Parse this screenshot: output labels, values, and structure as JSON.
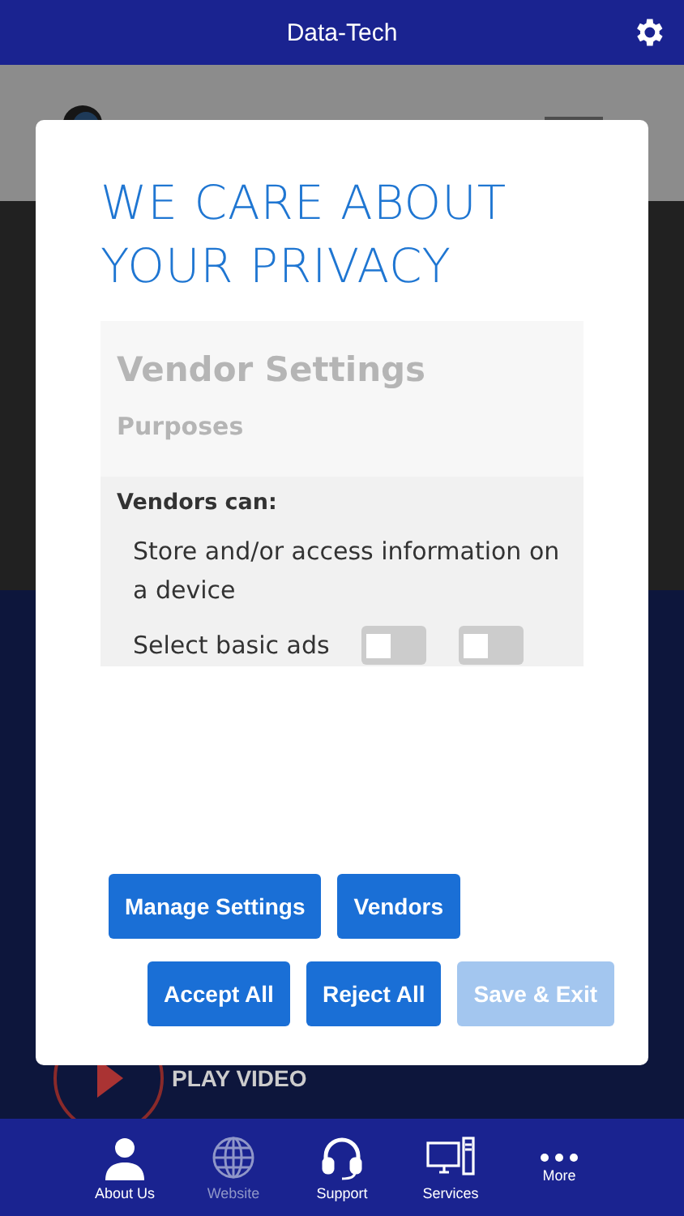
{
  "app_bar": {
    "title": "Data-Tech"
  },
  "background": {
    "play_label": "PLAY VIDEO"
  },
  "dialog": {
    "title": "WE CARE ABOUT YOUR PRIVACY",
    "panel": {
      "heading": "Vendor Settings",
      "subheading": "Purposes",
      "section_label": "Vendors can:",
      "items": [
        {
          "label": "Store and/or access information on a device"
        },
        {
          "label": "Select basic ads",
          "toggles": [
            {
              "checked": false
            },
            {
              "checked": false
            }
          ]
        }
      ]
    },
    "buttons": [
      [
        {
          "label": "Manage Settings",
          "disabled": false
        },
        {
          "label": "Vendors",
          "disabled": false
        }
      ],
      [
        {
          "label": "Accept All",
          "disabled": false
        },
        {
          "label": "Reject All",
          "disabled": false
        },
        {
          "label": "Save & Exit",
          "disabled": true
        }
      ]
    ]
  },
  "tab_bar": [
    {
      "label": "About Us",
      "disabled": false
    },
    {
      "label": "Website",
      "disabled": true
    },
    {
      "label": "Support",
      "disabled": false
    },
    {
      "label": "Services",
      "disabled": false
    },
    {
      "label": "More",
      "disabled": false
    }
  ]
}
